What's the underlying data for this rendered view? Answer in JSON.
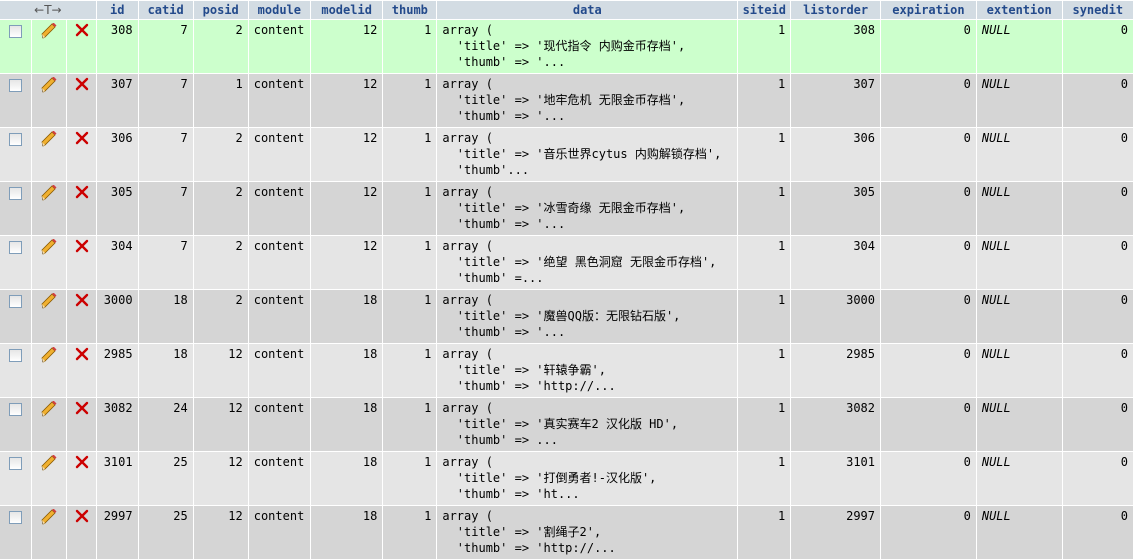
{
  "headers": {
    "nav": "←T→",
    "columns": [
      "id",
      "catid",
      "posid",
      "module",
      "modelid",
      "thumb",
      "data",
      "siteid",
      "listorder",
      "expiration",
      "extention",
      "synedit"
    ]
  },
  "rows": [
    {
      "id": "308",
      "catid": "7",
      "posid": "2",
      "module": "content",
      "modelid": "12",
      "thumb": "1",
      "data": [
        "array (",
        "  'title' => '现代指令 内购金币存档',",
        "  'thumb' => '..."
      ],
      "siteid": "1",
      "listorder": "308",
      "expiration": "0",
      "extention": "NULL",
      "synedit": "0",
      "highlight": true
    },
    {
      "id": "307",
      "catid": "7",
      "posid": "1",
      "module": "content",
      "modelid": "12",
      "thumb": "1",
      "data": [
        "array (",
        "  'title' => '地牢危机 无限金币存档',",
        "  'thumb' => '..."
      ],
      "siteid": "1",
      "listorder": "307",
      "expiration": "0",
      "extention": "NULL",
      "synedit": "0"
    },
    {
      "id": "306",
      "catid": "7",
      "posid": "2",
      "module": "content",
      "modelid": "12",
      "thumb": "1",
      "data": [
        "array (",
        "  'title' => '音乐世界cytus 内购解锁存档',",
        "  'thumb'..."
      ],
      "siteid": "1",
      "listorder": "306",
      "expiration": "0",
      "extention": "NULL",
      "synedit": "0"
    },
    {
      "id": "305",
      "catid": "7",
      "posid": "2",
      "module": "content",
      "modelid": "12",
      "thumb": "1",
      "data": [
        "array (",
        "  'title' => '冰雪奇缘 无限金币存档',",
        "  'thumb' => '..."
      ],
      "siteid": "1",
      "listorder": "305",
      "expiration": "0",
      "extention": "NULL",
      "synedit": "0"
    },
    {
      "id": "304",
      "catid": "7",
      "posid": "2",
      "module": "content",
      "modelid": "12",
      "thumb": "1",
      "data": [
        "array (",
        "  'title' => '绝望 黑色洞窟 无限金币存档',",
        "  'thumb' =..."
      ],
      "siteid": "1",
      "listorder": "304",
      "expiration": "0",
      "extention": "NULL",
      "synedit": "0"
    },
    {
      "id": "3000",
      "catid": "18",
      "posid": "2",
      "module": "content",
      "modelid": "18",
      "thumb": "1",
      "data": [
        "array (",
        "  'title' => '魔兽QQ版：无限钻石版',",
        "  'thumb' => '..."
      ],
      "siteid": "1",
      "listorder": "3000",
      "expiration": "0",
      "extention": "NULL",
      "synedit": "0"
    },
    {
      "id": "2985",
      "catid": "18",
      "posid": "12",
      "module": "content",
      "modelid": "18",
      "thumb": "1",
      "data": [
        "array (",
        "  'title' => '轩辕争霸',",
        "  'thumb' => 'http://..."
      ],
      "siteid": "1",
      "listorder": "2985",
      "expiration": "0",
      "extention": "NULL",
      "synedit": "0"
    },
    {
      "id": "3082",
      "catid": "24",
      "posid": "12",
      "module": "content",
      "modelid": "18",
      "thumb": "1",
      "data": [
        "array (",
        "  'title' => '真实赛车2 汉化版 HD',",
        "  'thumb' => ..."
      ],
      "siteid": "1",
      "listorder": "3082",
      "expiration": "0",
      "extention": "NULL",
      "synedit": "0"
    },
    {
      "id": "3101",
      "catid": "25",
      "posid": "12",
      "module": "content",
      "modelid": "18",
      "thumb": "1",
      "data": [
        "array (",
        "  'title' => '打倒勇者!-汉化版',",
        "  'thumb' => 'ht..."
      ],
      "siteid": "1",
      "listorder": "3101",
      "expiration": "0",
      "extention": "NULL",
      "synedit": "0"
    },
    {
      "id": "2997",
      "catid": "25",
      "posid": "12",
      "module": "content",
      "modelid": "18",
      "thumb": "1",
      "data": [
        "array (",
        "  'title' => '割绳子2',",
        "  'thumb' => 'http://..."
      ],
      "siteid": "1",
      "listorder": "2997",
      "expiration": "0",
      "extention": "NULL",
      "synedit": "0"
    }
  ],
  "icons": {
    "checkbox": "checkbox-icon",
    "edit": "pencil-icon",
    "delete": "delete-x-icon"
  },
  "colors": {
    "header_bg": "#d3dce3",
    "header_text": "#234a8b",
    "row_odd": "#e5e5e5",
    "row_even": "#d5d5d5",
    "row_highlight": "#ccffcc",
    "delete_red": "#cc0000"
  }
}
